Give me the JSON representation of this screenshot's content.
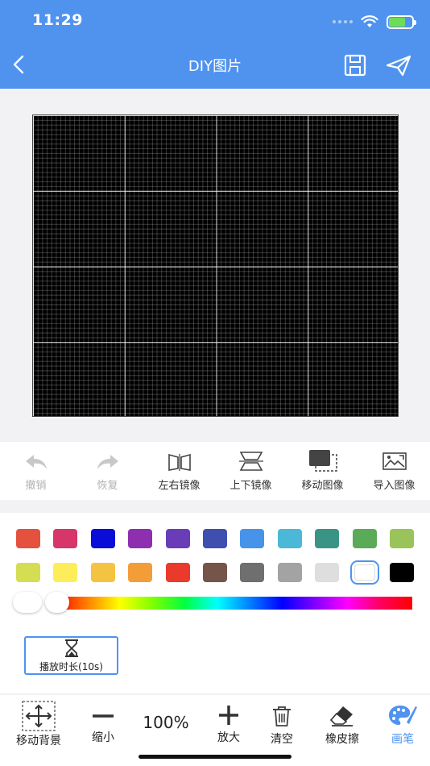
{
  "status": {
    "time": "11:29"
  },
  "nav": {
    "title": "DIY图片"
  },
  "toolbar": [
    {
      "label": "撤销",
      "enabled": false
    },
    {
      "label": "恢复",
      "enabled": false
    },
    {
      "label": "左右镜像",
      "enabled": true
    },
    {
      "label": "上下镜像",
      "enabled": true
    },
    {
      "label": "移动图像",
      "enabled": true
    },
    {
      "label": "导入图像",
      "enabled": true
    }
  ],
  "palette": {
    "row1": [
      "#e4513f",
      "#d6366a",
      "#0a0cd8",
      "#8e2fb0",
      "#6a3cb8",
      "#3f4fb0",
      "#4893ea",
      "#4ab8d6",
      "#3a9486",
      "#5aaa58",
      "#9ac35a"
    ],
    "row2": [
      "#d5dd52",
      "#fded5b",
      "#f5c342",
      "#f29d38",
      "#e93a2c",
      "#75544a",
      "#6f6f6f",
      "#a3a3a3",
      "#dedede",
      "#ffffff",
      "#000000"
    ],
    "selected_index": 9,
    "slider_fraction": 0.0
  },
  "duration": {
    "label": "播放时长(10s)"
  },
  "bottom": {
    "move_bg": "移动背景",
    "zoom_out": "缩小",
    "zoom_level": "100%",
    "zoom_in": "放大",
    "clear": "清空",
    "eraser": "橡皮擦",
    "brush": "画笔"
  },
  "colors": {
    "accent": "#4f93ef",
    "canvas_bg": "#000000"
  }
}
